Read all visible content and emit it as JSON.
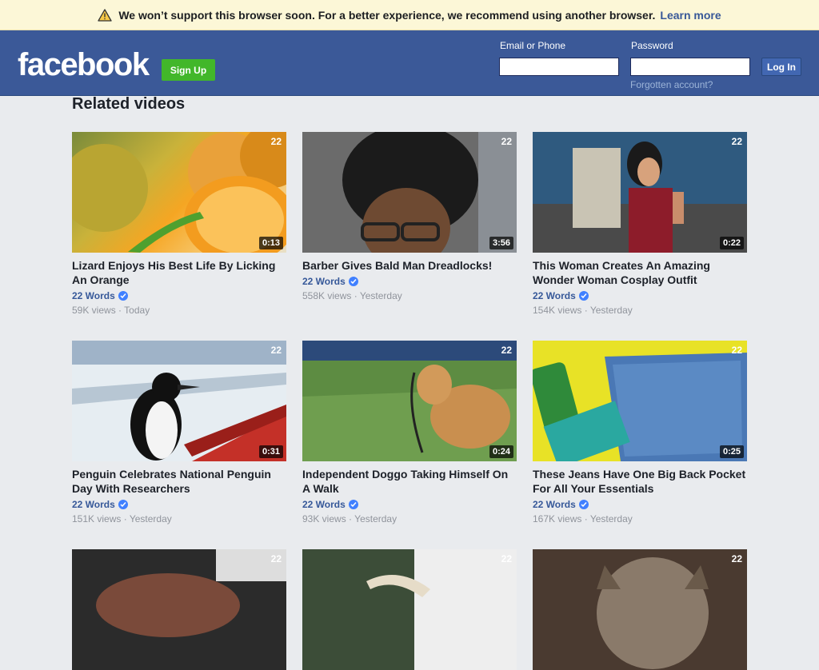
{
  "banner": {
    "message": "We won’t support this browser soon. For a better experience, we recommend using another browser.",
    "link": "Learn more"
  },
  "header": {
    "logo": "facebook",
    "signup_label": "Sign Up",
    "email_label": "Email or Phone",
    "password_label": "Password",
    "login_label": "Log In",
    "forgot_label": "Forgotten account?"
  },
  "section_title": "Related videos",
  "badge_text": "22",
  "videos": [
    {
      "title": "Lizard Enjoys His Best Life By Licking An Orange",
      "page": "22 Words",
      "views": "59K views",
      "dot": "·",
      "time": "Today",
      "duration": "0:13"
    },
    {
      "title": "Barber Gives Bald Man Dreadlocks!",
      "page": "22 Words",
      "views": "558K views",
      "dot": "·",
      "time": "Yesterday",
      "duration": "3:56"
    },
    {
      "title": "This Woman Creates An Amazing Wonder Woman Cosplay Outfit",
      "page": "22 Words",
      "views": "154K views",
      "dot": "·",
      "time": "Yesterday",
      "duration": "0:22"
    },
    {
      "title": "Penguin Celebrates National Penguin Day With Researchers",
      "page": "22 Words",
      "views": "151K views",
      "dot": "·",
      "time": "Yesterday",
      "duration": "0:31"
    },
    {
      "title": "Independent Doggo Taking Himself On A Walk",
      "page": "22 Words",
      "views": "93K views",
      "dot": "·",
      "time": "Yesterday",
      "duration": "0:24"
    },
    {
      "title": "These Jeans Have One Big Back Pocket For All Your Essentials",
      "page": "22 Words",
      "views": "167K views",
      "dot": "·",
      "time": "Yesterday",
      "duration": "0:25"
    }
  ],
  "colors": {
    "header": "#3b5998",
    "signup": "#42b72a",
    "link": "#365899",
    "verified": "#4080ff"
  }
}
